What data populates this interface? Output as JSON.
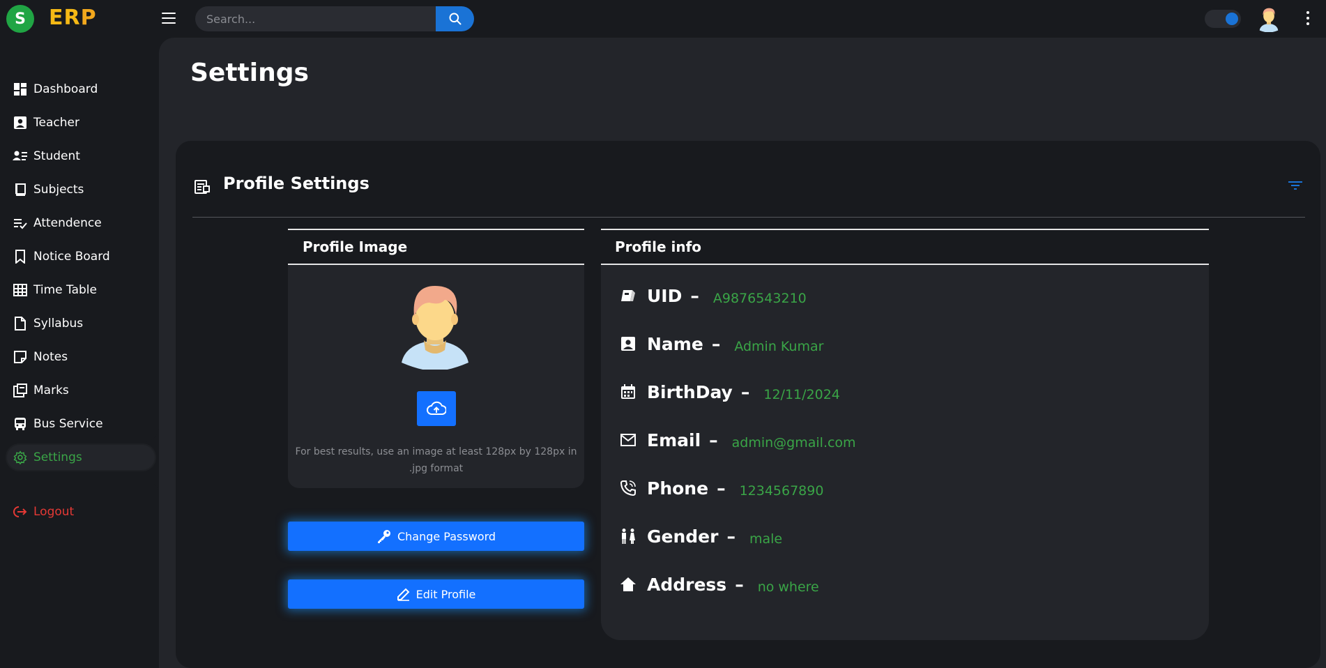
{
  "app": {
    "logo_letter": "S",
    "logo_er": "ER",
    "logo_p": "P"
  },
  "header": {
    "search_placeholder": "Search...",
    "theme_toggle_on": true
  },
  "sidebar": {
    "items": [
      {
        "label": "Dashboard",
        "icon": "dashboard-icon"
      },
      {
        "label": "Teacher",
        "icon": "teacher-icon"
      },
      {
        "label": "Student",
        "icon": "student-icon"
      },
      {
        "label": "Subjects",
        "icon": "book-icon"
      },
      {
        "label": "Attendence",
        "icon": "checklist-icon"
      },
      {
        "label": "Notice Board",
        "icon": "bookmark-icon"
      },
      {
        "label": "Time Table",
        "icon": "grid-icon"
      },
      {
        "label": "Syllabus",
        "icon": "file-icon"
      },
      {
        "label": "Notes",
        "icon": "note-icon"
      },
      {
        "label": "Marks",
        "icon": "marks-icon"
      },
      {
        "label": "Bus Service",
        "icon": "bus-icon"
      },
      {
        "label": "Settings",
        "icon": "gear-icon",
        "active": true
      }
    ],
    "logout_label": "Logout"
  },
  "page": {
    "title": "Settings"
  },
  "profile_settings": {
    "title": "Profile Settings",
    "image_panel": {
      "title": "Profile Image",
      "hint": "For best results, use an image at least 128px by 128px in .jpg format"
    },
    "change_password_label": "Change Password",
    "edit_profile_label": "Edit Profile",
    "info_panel": {
      "title": "Profile info",
      "rows": [
        {
          "key": "UID",
          "value": "A9876543210",
          "icon": "tag-icon"
        },
        {
          "key": "Name",
          "value": "Admin Kumar",
          "icon": "contact-icon"
        },
        {
          "key": "BirthDay",
          "value": "12/11/2024",
          "icon": "calendar-icon"
        },
        {
          "key": "Email",
          "value": "admin@gmail.com",
          "icon": "mail-icon"
        },
        {
          "key": "Phone",
          "value": "1234567890",
          "icon": "phone-icon"
        },
        {
          "key": "Gender",
          "value": "male",
          "icon": "gender-icon"
        },
        {
          "key": "Address",
          "value": "no where",
          "icon": "home-icon"
        }
      ]
    }
  },
  "colors": {
    "accent_blue": "#1370ff",
    "value_green": "#3aa547",
    "logout_red": "#e53935",
    "logo_green": "#20a544",
    "logo_yellow": "#f5b915"
  }
}
